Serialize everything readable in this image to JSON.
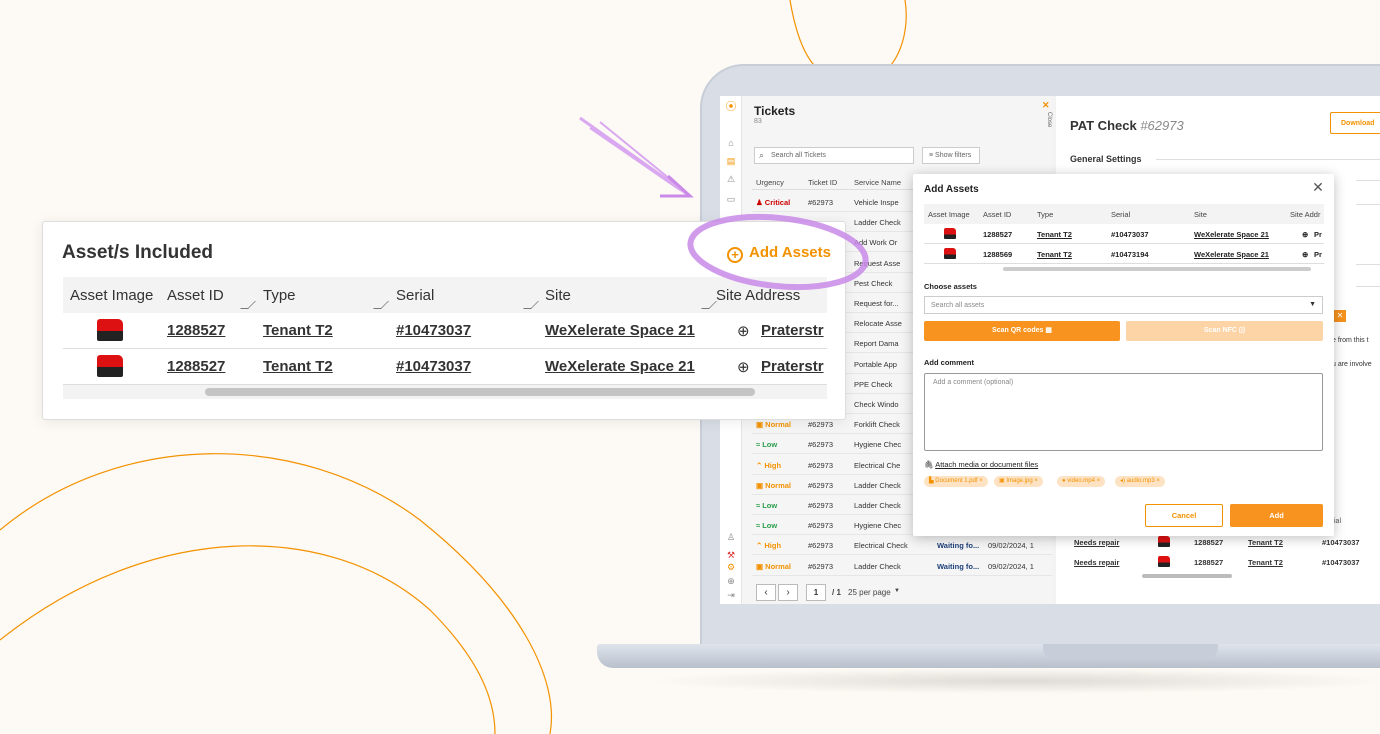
{
  "colors": {
    "accent": "#f39200",
    "critical": "#cc0000",
    "low": "#2a9d4a",
    "background": "#fdf9f4"
  },
  "tickets_panel": {
    "title": "Tickets",
    "count": "83",
    "close_label": "Close",
    "search_placeholder": "Search all Tickets",
    "show_filters": "Show filters",
    "columns": [
      "Urgency",
      "Ticket ID",
      "Service Name"
    ],
    "rows": [
      {
        "urgency": "Critical",
        "id": "#62973",
        "service": "Vehicle Inspe"
      },
      {
        "urgency": "",
        "id": "",
        "service": "Ladder Check"
      },
      {
        "urgency": "",
        "id": "",
        "service": "Add Work Or"
      },
      {
        "urgency": "",
        "id": "",
        "service": "Request Asse"
      },
      {
        "urgency": "",
        "id": "",
        "service": "Pest Check"
      },
      {
        "urgency": "",
        "id": "",
        "service": "Request for..."
      },
      {
        "urgency": "",
        "id": "",
        "service": "Relocate Asse"
      },
      {
        "urgency": "",
        "id": "",
        "service": "Report Dama"
      },
      {
        "urgency": "",
        "id": "",
        "service": "Portable App"
      },
      {
        "urgency": "",
        "id": "",
        "service": "PPE Check"
      },
      {
        "urgency": "",
        "id": "",
        "service": "Check Windo"
      },
      {
        "urgency": "Normal",
        "id": "#62973",
        "service": "Forklift Check"
      },
      {
        "urgency": "Low",
        "id": "#62973",
        "service": "Hygiene Chec"
      },
      {
        "urgency": "High",
        "id": "#62973",
        "service": "Electrical Che"
      },
      {
        "urgency": "Normal",
        "id": "#62973",
        "service": "Ladder Check"
      },
      {
        "urgency": "Low",
        "id": "#62973",
        "service": "Ladder Check"
      },
      {
        "urgency": "Low",
        "id": "#62973",
        "service": "Hygiene Chec"
      },
      {
        "urgency": "High",
        "id": "#62973",
        "service": "Electrical Check",
        "status": "Waiting fo...",
        "date": "09/02/2024, 1"
      },
      {
        "urgency": "Normal",
        "id": "#62973",
        "service": "Ladder Check",
        "status": "Waiting fo...",
        "date": "09/02/2024, 1"
      }
    ],
    "pagination": {
      "page": "1",
      "total": "/ 1",
      "per_page": "25 per page"
    }
  },
  "detail": {
    "title": "PAT Check",
    "ticket_no": "#62973",
    "download": "Download",
    "general_settings": "General Settings",
    "snippet1": "e from this t",
    "snippet2": "u are involve",
    "col_serial": "ial",
    "rows": [
      {
        "state": "Needs repair",
        "asset_id": "1288527",
        "type": "Tenant T2",
        "serial": "#10473037"
      },
      {
        "state": "Needs repair",
        "asset_id": "1288527",
        "type": "Tenant T2",
        "serial": "#10473037"
      }
    ]
  },
  "modal": {
    "title": "Add Assets",
    "columns": [
      "Asset Image",
      "Asset ID",
      "Type",
      "Serial",
      "Site",
      "Site Addr"
    ],
    "rows": [
      {
        "id": "1288527",
        "type": "Tenant T2",
        "serial": "#10473037",
        "site": "WeXelerate Space 21",
        "addr": "Pr"
      },
      {
        "id": "1288569",
        "type": "Tenant T2",
        "serial": "#10473194",
        "site": "WeXelerate Space 21",
        "addr": "Pr"
      }
    ],
    "choose_label": "Choose assets",
    "search_placeholder": "Search all assets",
    "scan_qr": "Scan QR codes",
    "scan_nfc": "Scan NFC",
    "comment_label": "Add comment",
    "comment_placeholder": "Add a comment (optional)",
    "attach_label": "Attach media or document files",
    "files": [
      "Document 1.pdf",
      "Image.jpg",
      "video.mp4",
      "audio.mp3"
    ],
    "cancel": "Cancel",
    "add": "Add"
  },
  "card": {
    "title": "Asset/s Included",
    "add_assets": "Add Assets",
    "columns": [
      "Asset Image",
      "Asset ID",
      "Type",
      "Serial",
      "Site",
      "Site Address"
    ],
    "rows": [
      {
        "id": "1288527",
        "type": "Tenant T2",
        "serial": "#10473037",
        "site": "WeXelerate Space 21",
        "addr": "Praterstr"
      },
      {
        "id": "1288527",
        "type": "Tenant T2",
        "serial": "#10473037",
        "site": "WeXelerate Space 21",
        "addr": "Praterstr"
      }
    ]
  }
}
